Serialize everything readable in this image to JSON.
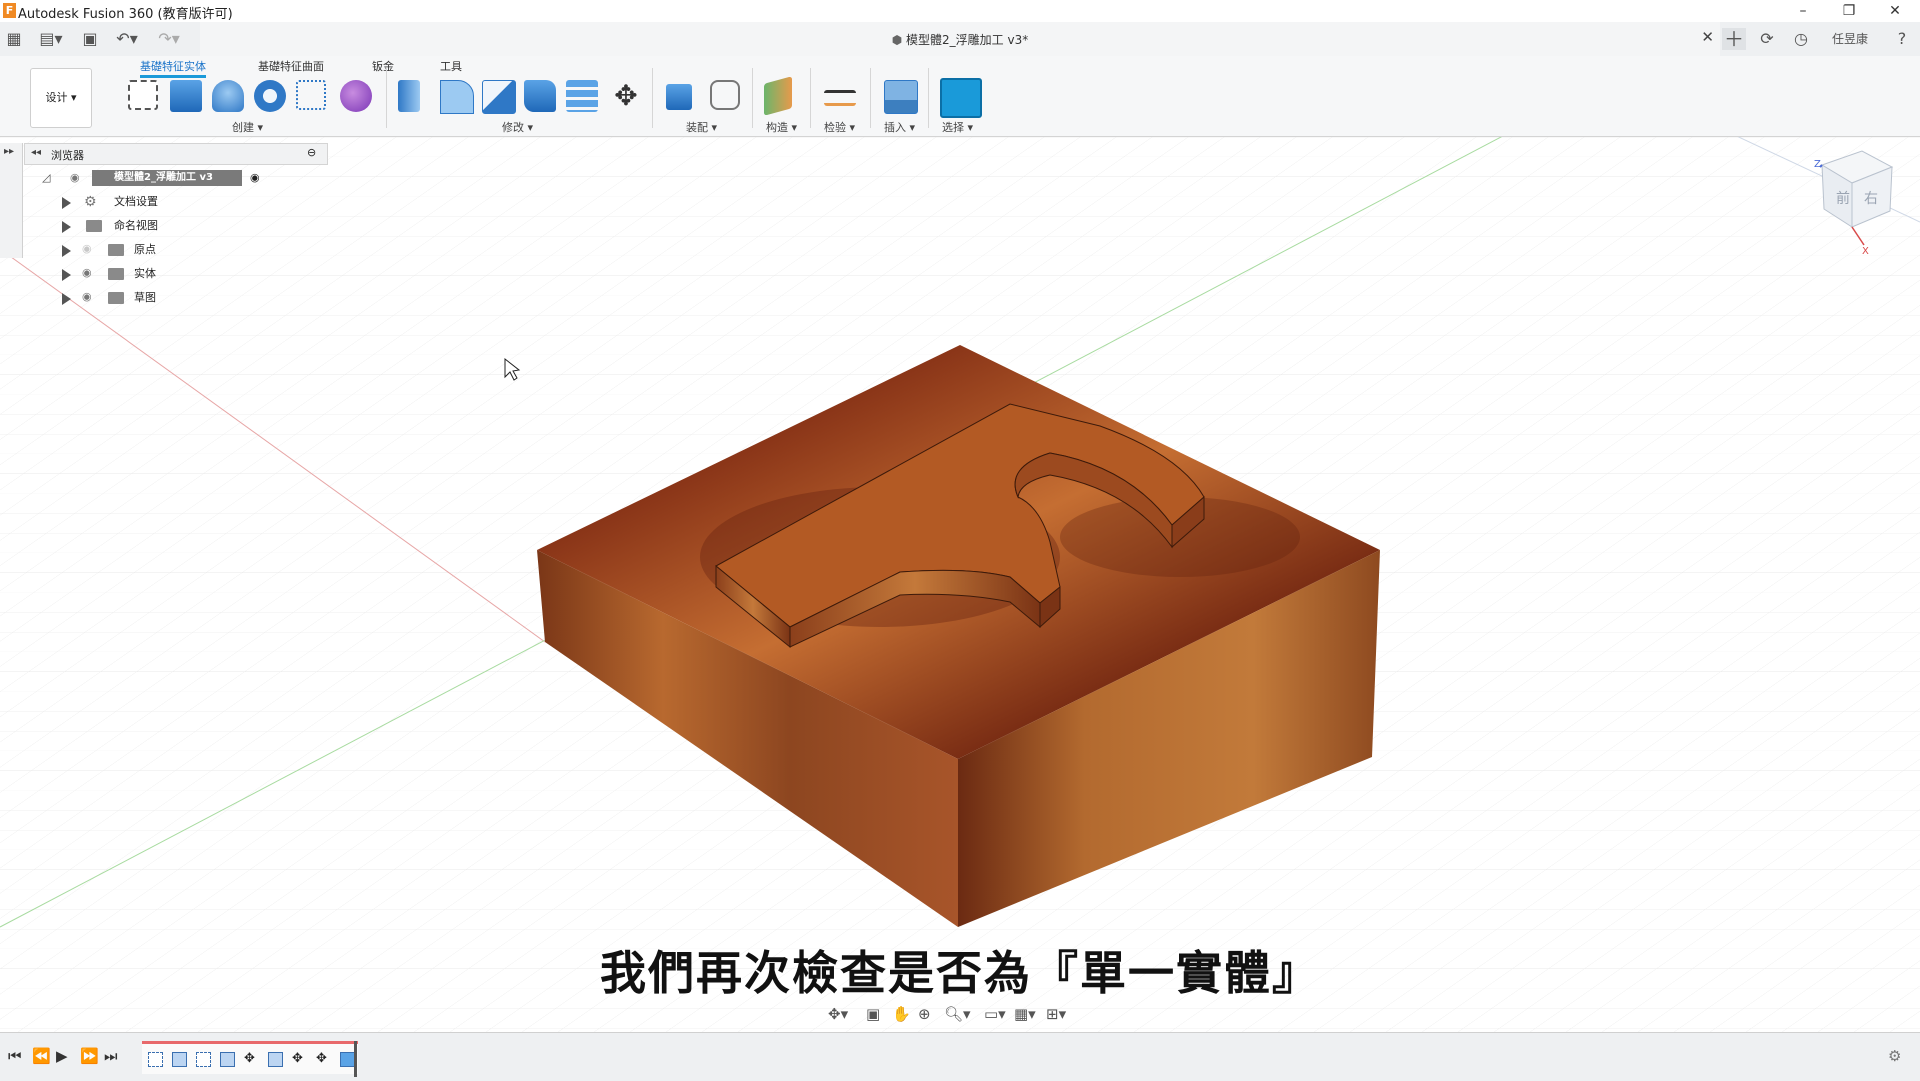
{
  "app": {
    "title": "Autodesk Fusion 360 (教育版许可)",
    "logo_letter": "F"
  },
  "window_controls": [
    "–",
    "❐",
    "✕"
  ],
  "document_tab": {
    "name": "模型體2_浮雕加工 v3*",
    "close": "✕"
  },
  "user": {
    "name": "任昱康"
  },
  "ribbon": {
    "workspace_label": "设计 ▾",
    "tabs": [
      "基礎特征实体",
      "基礎特征曲面",
      "钣金",
      "工具"
    ],
    "active_tab": "基礎特征实体",
    "groups": [
      "创建 ▾",
      "修改 ▾",
      "装配 ▾",
      "构造 ▾",
      "检验 ▾",
      "插入 ▾",
      "选择 ▾"
    ]
  },
  "browser": {
    "title": "浏览器",
    "root_label": "模型體2_浮雕加工 v3",
    "items": [
      {
        "label": "文档设置",
        "icon": "gear-icon"
      },
      {
        "label": "命名视图",
        "icon": "folder-icon"
      },
      {
        "label": "原点",
        "icon": "folder-icon"
      },
      {
        "label": "实体",
        "icon": "folder-icon"
      },
      {
        "label": "草图",
        "icon": "folder-icon"
      }
    ]
  },
  "viewcube": {
    "front": "前",
    "right": "右",
    "z_axis": "Z",
    "x_axis": "X"
  },
  "caption": "我們再次檢查是否為『單一實體』",
  "colors": {
    "accent": "#1a9ad9",
    "wood_light": "#c0642a",
    "wood_dark": "#6e2512",
    "timeline_marker": "#e8696b"
  }
}
